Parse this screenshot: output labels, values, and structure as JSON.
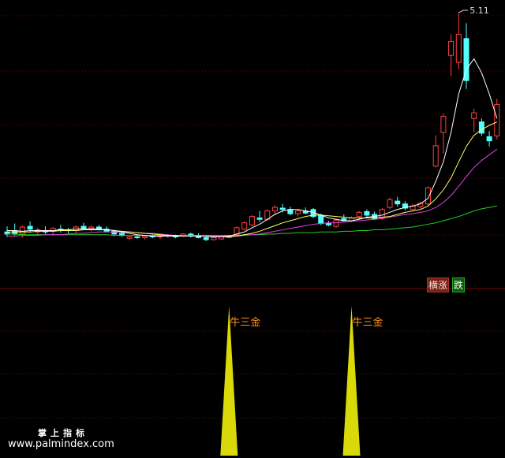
{
  "chart_data": [
    {
      "type": "candlestick",
      "panel": "price",
      "annotations": [
        {
          "text": "5.11",
          "kind": "high-marker"
        }
      ],
      "ylim": [
        1.6,
        5.2
      ],
      "grid": "dotted-red-horizontal",
      "colors": {
        "up": "#ff4040",
        "down": "#54ffff",
        "ma_fast": "#ffffff",
        "ma_mid": "#ffff66",
        "ma_slow": "#e040e0",
        "ma_long": "#20d020"
      },
      "candles": [
        {
          "o": 1.98,
          "h": 2.06,
          "l": 1.91,
          "c": 1.95
        },
        {
          "o": 2.0,
          "h": 2.1,
          "l": 1.93,
          "c": 1.95
        },
        {
          "o": 1.95,
          "h": 2.07,
          "l": 1.9,
          "c": 2.05
        },
        {
          "o": 2.06,
          "h": 2.13,
          "l": 1.97,
          "c": 2.02
        },
        {
          "o": 1.98,
          "h": 2.04,
          "l": 1.94,
          "c": 2.01
        },
        {
          "o": 2.0,
          "h": 2.06,
          "l": 1.95,
          "c": 1.98
        },
        {
          "o": 1.99,
          "h": 2.05,
          "l": 1.93,
          "c": 2.03
        },
        {
          "o": 2.02,
          "h": 2.08,
          "l": 1.97,
          "c": 2.01
        },
        {
          "o": 2.01,
          "h": 2.04,
          "l": 1.96,
          "c": 2.0
        },
        {
          "o": 2.0,
          "h": 2.07,
          "l": 1.96,
          "c": 2.05
        },
        {
          "o": 2.06,
          "h": 2.11,
          "l": 2.01,
          "c": 2.03
        },
        {
          "o": 2.03,
          "h": 2.07,
          "l": 1.99,
          "c": 2.05
        },
        {
          "o": 2.05,
          "h": 2.08,
          "l": 2.0,
          "c": 2.02
        },
        {
          "o": 2.02,
          "h": 2.06,
          "l": 1.97,
          "c": 1.99
        },
        {
          "o": 1.99,
          "h": 2.01,
          "l": 1.92,
          "c": 1.95
        },
        {
          "o": 1.96,
          "h": 1.99,
          "l": 1.91,
          "c": 1.93
        },
        {
          "o": 1.89,
          "h": 1.92,
          "l": 1.86,
          "c": 1.91
        },
        {
          "o": 1.91,
          "h": 1.94,
          "l": 1.88,
          "c": 1.9
        },
        {
          "o": 1.9,
          "h": 1.93,
          "l": 1.87,
          "c": 1.92
        },
        {
          "o": 1.92,
          "h": 1.94,
          "l": 1.89,
          "c": 1.91
        },
        {
          "o": 1.91,
          "h": 1.93,
          "l": 1.88,
          "c": 1.92
        },
        {
          "o": 1.92,
          "h": 1.95,
          "l": 1.9,
          "c": 1.93
        },
        {
          "o": 1.92,
          "h": 1.94,
          "l": 1.89,
          "c": 1.91
        },
        {
          "o": 1.93,
          "h": 1.96,
          "l": 1.91,
          "c": 1.95
        },
        {
          "o": 1.95,
          "h": 1.97,
          "l": 1.9,
          "c": 1.92
        },
        {
          "o": 1.93,
          "h": 1.96,
          "l": 1.89,
          "c": 1.9
        },
        {
          "o": 1.9,
          "h": 1.92,
          "l": 1.85,
          "c": 1.87
        },
        {
          "o": 1.87,
          "h": 1.91,
          "l": 1.86,
          "c": 1.9
        },
        {
          "o": 1.88,
          "h": 1.92,
          "l": 1.87,
          "c": 1.91
        },
        {
          "o": 1.9,
          "h": 1.94,
          "l": 1.89,
          "c": 1.93
        },
        {
          "o": 1.94,
          "h": 2.06,
          "l": 1.92,
          "c": 2.04
        },
        {
          "o": 2.02,
          "h": 2.13,
          "l": 2.0,
          "c": 2.11
        },
        {
          "o": 2.08,
          "h": 2.22,
          "l": 2.06,
          "c": 2.2
        },
        {
          "o": 2.18,
          "h": 2.28,
          "l": 2.12,
          "c": 2.16
        },
        {
          "o": 2.16,
          "h": 2.3,
          "l": 2.14,
          "c": 2.28
        },
        {
          "o": 2.28,
          "h": 2.36,
          "l": 2.22,
          "c": 2.33
        },
        {
          "o": 2.32,
          "h": 2.38,
          "l": 2.26,
          "c": 2.3
        },
        {
          "o": 2.3,
          "h": 2.34,
          "l": 2.22,
          "c": 2.24
        },
        {
          "o": 2.24,
          "h": 2.3,
          "l": 2.2,
          "c": 2.28
        },
        {
          "o": 2.28,
          "h": 2.33,
          "l": 2.23,
          "c": 2.25
        },
        {
          "o": 2.3,
          "h": 2.32,
          "l": 2.18,
          "c": 2.2
        },
        {
          "o": 2.22,
          "h": 2.24,
          "l": 2.08,
          "c": 2.1
        },
        {
          "o": 2.1,
          "h": 2.14,
          "l": 2.06,
          "c": 2.08
        },
        {
          "o": 2.06,
          "h": 2.17,
          "l": 2.04,
          "c": 2.15
        },
        {
          "o": 2.17,
          "h": 2.23,
          "l": 2.13,
          "c": 2.14
        },
        {
          "o": 2.14,
          "h": 2.2,
          "l": 2.12,
          "c": 2.18
        },
        {
          "o": 2.2,
          "h": 2.28,
          "l": 2.16,
          "c": 2.26
        },
        {
          "o": 2.27,
          "h": 2.3,
          "l": 2.2,
          "c": 2.22
        },
        {
          "o": 2.23,
          "h": 2.27,
          "l": 2.15,
          "c": 2.17
        },
        {
          "o": 2.18,
          "h": 2.32,
          "l": 2.15,
          "c": 2.3
        },
        {
          "o": 2.33,
          "h": 2.47,
          "l": 2.3,
          "c": 2.44
        },
        {
          "o": 2.42,
          "h": 2.48,
          "l": 2.34,
          "c": 2.38
        },
        {
          "o": 2.38,
          "h": 2.42,
          "l": 2.29,
          "c": 2.32
        },
        {
          "o": 2.3,
          "h": 2.38,
          "l": 2.27,
          "c": 2.35
        },
        {
          "o": 2.34,
          "h": 2.41,
          "l": 2.31,
          "c": 2.39
        },
        {
          "o": 2.38,
          "h": 2.63,
          "l": 2.35,
          "c": 2.61
        },
        {
          "o": 2.92,
          "h": 3.36,
          "l": 2.9,
          "c": 3.21
        },
        {
          "o": 3.4,
          "h": 3.67,
          "l": 3.1,
          "c": 3.63
        },
        {
          "o": 4.5,
          "h": 4.8,
          "l": 4.2,
          "c": 4.7
        },
        {
          "o": 4.4,
          "h": 5.11,
          "l": 4.3,
          "c": 4.8
        },
        {
          "o": 4.74,
          "h": 4.96,
          "l": 4.02,
          "c": 4.14
        },
        {
          "o": 3.6,
          "h": 3.74,
          "l": 3.4,
          "c": 3.68
        },
        {
          "o": 3.55,
          "h": 3.6,
          "l": 3.35,
          "c": 3.39
        },
        {
          "o": 3.34,
          "h": 3.42,
          "l": 3.2,
          "c": 3.28
        },
        {
          "o": 3.35,
          "h": 3.88,
          "l": 3.3,
          "c": 3.8
        }
      ],
      "ma_fast": [
        2.0,
        2.0,
        1.99,
        2.0,
        2.0,
        2.0,
        2.0,
        2.01,
        2.01,
        2.02,
        2.02,
        2.02,
        2.02,
        2.01,
        2.0,
        1.98,
        1.96,
        1.94,
        1.93,
        1.92,
        1.92,
        1.92,
        1.92,
        1.92,
        1.92,
        1.92,
        1.92,
        1.91,
        1.91,
        1.92,
        1.95,
        1.98,
        2.04,
        2.09,
        2.16,
        2.23,
        2.28,
        2.3,
        2.3,
        2.28,
        2.26,
        2.22,
        2.18,
        2.16,
        2.14,
        2.14,
        2.16,
        2.19,
        2.2,
        2.22,
        2.26,
        2.3,
        2.33,
        2.35,
        2.38,
        2.46,
        2.7,
        2.98,
        3.4,
        3.95,
        4.3,
        4.45,
        4.25,
        3.95,
        3.6
      ],
      "ma_mid": [
        1.98,
        1.98,
        1.98,
        1.98,
        1.99,
        1.99,
        1.99,
        2.0,
        2.0,
        2.0,
        2.01,
        2.01,
        2.01,
        2.01,
        2.0,
        1.99,
        1.98,
        1.97,
        1.96,
        1.95,
        1.94,
        1.93,
        1.93,
        1.92,
        1.92,
        1.92,
        1.92,
        1.91,
        1.91,
        1.91,
        1.92,
        1.94,
        1.96,
        1.99,
        2.03,
        2.07,
        2.11,
        2.14,
        2.17,
        2.2,
        2.22,
        2.22,
        2.21,
        2.2,
        2.19,
        2.18,
        2.18,
        2.18,
        2.18,
        2.19,
        2.2,
        2.23,
        2.26,
        2.28,
        2.3,
        2.35,
        2.45,
        2.58,
        2.75,
        2.98,
        3.2,
        3.36,
        3.44,
        3.5,
        3.55
      ],
      "ma_slow": [
        1.92,
        1.92,
        1.93,
        1.93,
        1.93,
        1.94,
        1.94,
        1.94,
        1.95,
        1.96,
        1.96,
        1.97,
        1.98,
        1.98,
        1.98,
        1.98,
        1.98,
        1.97,
        1.96,
        1.96,
        1.95,
        1.94,
        1.93,
        1.93,
        1.92,
        1.92,
        1.92,
        1.92,
        1.92,
        1.92,
        1.92,
        1.93,
        1.94,
        1.95,
        1.97,
        1.99,
        2.01,
        2.03,
        2.05,
        2.07,
        2.09,
        2.1,
        2.11,
        2.11,
        2.12,
        2.13,
        2.14,
        2.15,
        2.16,
        2.17,
        2.19,
        2.21,
        2.23,
        2.24,
        2.26,
        2.28,
        2.33,
        2.4,
        2.5,
        2.63,
        2.77,
        2.9,
        3.0,
        3.08,
        3.16
      ],
      "ma_long": [
        1.95,
        1.95,
        1.94,
        1.94,
        1.94,
        1.94,
        1.94,
        1.94,
        1.94,
        1.94,
        1.94,
        1.94,
        1.94,
        1.94,
        1.93,
        1.93,
        1.93,
        1.93,
        1.93,
        1.93,
        1.93,
        1.93,
        1.93,
        1.93,
        1.93,
        1.93,
        1.93,
        1.93,
        1.93,
        1.93,
        1.93,
        1.94,
        1.94,
        1.94,
        1.95,
        1.95,
        1.96,
        1.96,
        1.97,
        1.97,
        1.97,
        1.98,
        1.98,
        1.98,
        1.99,
        1.99,
        2.0,
        2.0,
        2.01,
        2.01,
        2.02,
        2.03,
        2.04,
        2.05,
        2.07,
        2.09,
        2.11,
        2.14,
        2.17,
        2.2,
        2.24,
        2.28,
        2.31,
        2.33,
        2.35
      ]
    },
    {
      "type": "signal",
      "panel": "indicator",
      "signals": [
        {
          "index": 29,
          "label": "牛三金"
        },
        {
          "index": 45,
          "label": "牛三金"
        }
      ],
      "color": "#d9d90a"
    }
  ],
  "legend": {
    "up_label": "横涨",
    "down_label": "跌"
  },
  "watermark": {
    "title": "掌上指标",
    "url": "www.palmindex.com"
  }
}
